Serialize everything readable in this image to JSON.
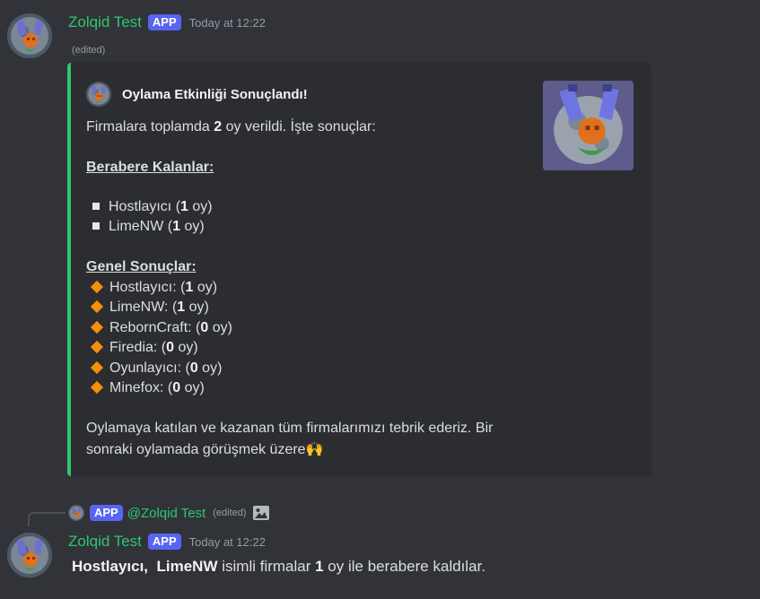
{
  "message1": {
    "username": "Zolqid Test",
    "badge": "APP",
    "timestamp": "Today at 12:22",
    "edited": "(edited)",
    "embed": {
      "author": "Oylama Etkinliği Sonuçlandı!",
      "intro_pre": "Firmalara toplamda ",
      "intro_bold": "2",
      "intro_post": " oy verildi. İşte sonuçlar:",
      "tie_heading": "Berabere Kalanlar:",
      "tie_items": [
        {
          "name": "Hostlayıcı (",
          "votes": "1",
          "suffix": " oy)"
        },
        {
          "name": "LimeNW (",
          "votes": "1",
          "suffix": " oy)"
        }
      ],
      "general_heading": "Genel Sonuçlar:",
      "general_items": [
        {
          "name": "Hostlayıcı: (",
          "votes": "1",
          "suffix": " oy)"
        },
        {
          "name": "LimeNW: (",
          "votes": "1",
          "suffix": " oy)"
        },
        {
          "name": "RebornCraft: (",
          "votes": "0",
          "suffix": " oy)"
        },
        {
          "name": "Firedia: (",
          "votes": "0",
          "suffix": " oy)"
        },
        {
          "name": "Oyunlayıcı: (",
          "votes": "0",
          "suffix": " oy)"
        },
        {
          "name": "Minefox: (",
          "votes": "0",
          "suffix": " oy)"
        }
      ],
      "footer_line1": "Oylamaya katılan ve kazanan tüm firmalarımızı tebrik ederiz. Bir",
      "footer_line2": "sonraki oylamada görüşmek üzere",
      "footer_emoji": "🙌",
      "accent_color": "#2dc770"
    }
  },
  "reply": {
    "badge": "APP",
    "mention": "@Zolqid Test",
    "edited": "(edited)",
    "icon": "image-icon"
  },
  "message2": {
    "username": "Zolqid Test",
    "badge": "APP",
    "timestamp": "Today at 12:22",
    "name1": "Hostlayıcı,",
    "name2": "LimeNW",
    "text_mid": " isimli firmalar ",
    "count": "1",
    "text_end": " oy ile berabere kaldılar."
  }
}
